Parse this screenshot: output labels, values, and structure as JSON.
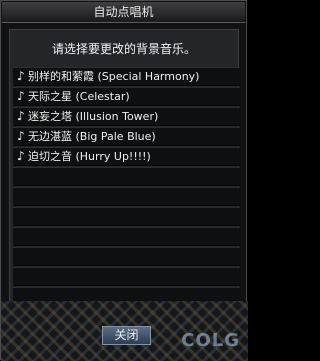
{
  "window": {
    "title": "自动点唱机"
  },
  "instruction": "请选择要更改的背景音乐。",
  "songs": [
    "别样的和萦霞 (Special Harmony)",
    "天际之星 (Celestar)",
    "迷妄之塔 (Illusion Tower)",
    "无边湛蓝 (Big Pale Blue)",
    "迫切之音 (Hurry Up!!!!)",
    "",
    "",
    "",
    "",
    "",
    "",
    "",
    ""
  ],
  "song_icon": "music-note-icon",
  "buttons": {
    "close": "关闭"
  },
  "watermark": "COLG"
}
